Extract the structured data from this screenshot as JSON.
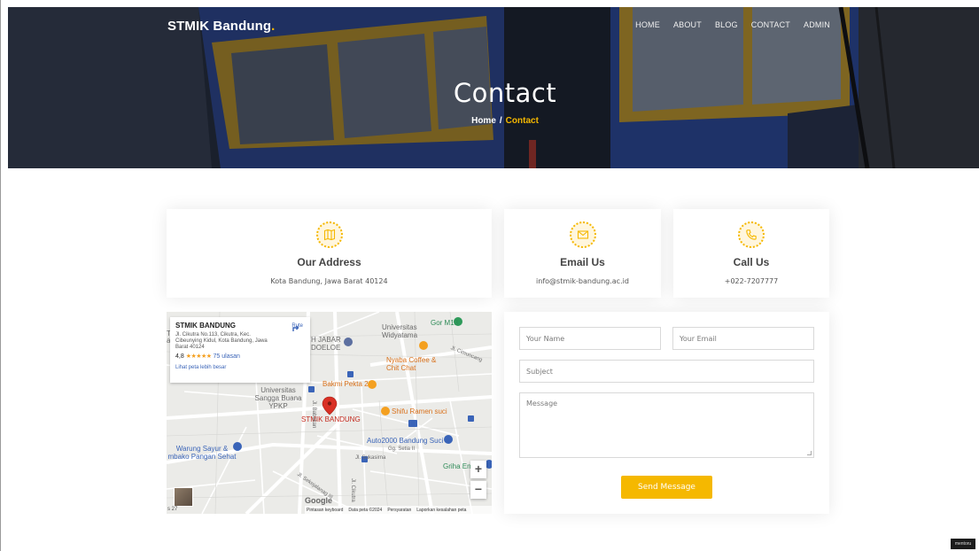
{
  "brand": {
    "name": "STMIK Bandung",
    "dot": "."
  },
  "nav": [
    "HOME",
    "ABOUT",
    "BLOG",
    "CONTACT",
    "ADMIN"
  ],
  "hero": {
    "title": "Contact",
    "breadcrumb_home": "Home",
    "breadcrumb_sep": "/",
    "breadcrumb_current": "Contact"
  },
  "info": {
    "address": {
      "title": "Our Address",
      "text": "Kota Bandung, Jawa Barat 40124",
      "icon": "map-icon"
    },
    "email": {
      "title": "Email Us",
      "text": "info@stmik-bandung.ac.id",
      "icon": "envelope-icon"
    },
    "phone": {
      "title": "Call Us",
      "text": "+022-7207777",
      "icon": "phone-icon"
    }
  },
  "map": {
    "place_name": "STMIK BANDUNG",
    "place_address": "Jl. Cikutra No.113, Cikutra, Kec. Cibeunying Kidul, Kota Bandung, Jawa Barat 40124",
    "rating": "4,8",
    "stars": "★★★★★",
    "review_count": "75 ulasan",
    "larger_map_link": "Lihat peta lebih besar",
    "route_label": "Rute",
    "marker_label": "STMIK BANDUNG",
    "labels": {
      "universitas_widyatama": "Universitas Widyatama",
      "gor": "Gor M13",
      "jabar": "H JABAR",
      "doeloe": "DOELOE",
      "nyaba": "Nyaba Coffee & Chit Chat",
      "bakmi": "Bakmi Pekta 2",
      "unsangga": "Universitas Sangga Buana YPKP",
      "shifu": "Shifu Ramen suci",
      "auto2000": "Auto2000 Bandung Suci",
      "setia": "Gg. Setia II",
      "sukasirna": "Jl. Sukasirna",
      "warung": "Warung Sayur & mbako Pangan Sehat",
      "griha": "Griha En",
      "cikutra": "Jl. Cikutra",
      "bojongloa": "Jl. Babakan",
      "sukajaya": "Jl. Sekejalanag III",
      "cimuncang": "Jl. Cimuncang",
      "tl": "T",
      "al": "al"
    },
    "google": "Google",
    "attrib": [
      "Pintasan keyboard",
      "Data peta ©2024",
      "Persyaratan",
      "Laporkan kesalahan peta"
    ],
    "zoom_in": "+",
    "zoom_out": "−",
    "scale": "s 27"
  },
  "form": {
    "name_placeholder": "Your Name",
    "email_placeholder": "Your Email",
    "subject_placeholder": "Subject",
    "message_placeholder": "Message",
    "submit": "Send Message"
  },
  "corner_badge": "mentoru",
  "colors": {
    "accent": "#f5b800",
    "link": "#3a64b8",
    "marker": "#d93025"
  }
}
